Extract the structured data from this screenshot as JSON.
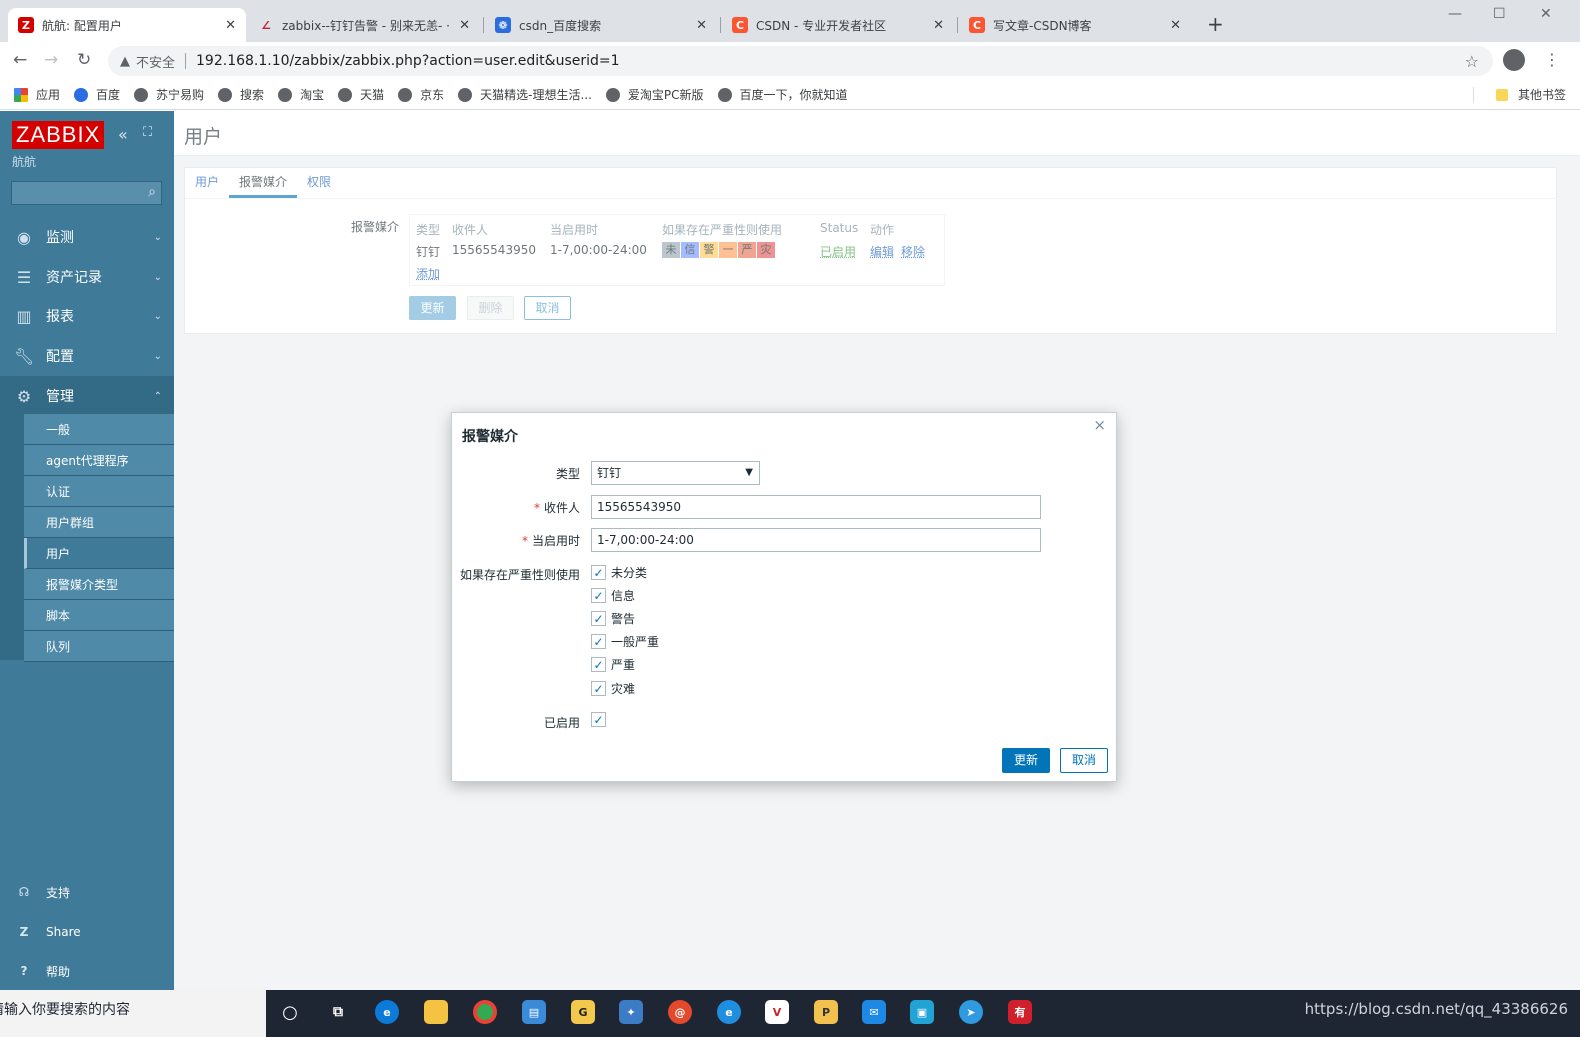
{
  "browser": {
    "tabs": [
      {
        "title": "航航: 配置用户",
        "icon": "zabbix-favicon",
        "color": "#d40000",
        "glyph": "Z"
      },
      {
        "title": "zabbix--钉钉告警 - 别来无恙- ·",
        "icon": "csdn-favicon",
        "color": "#c32136",
        "glyph": "∠"
      },
      {
        "title": "csdn_百度搜索",
        "icon": "baidu-favicon",
        "color": "#2b6de0",
        "glyph": "❁"
      },
      {
        "title": "CSDN - 专业开发者社区",
        "icon": "csdn-favicon",
        "color": "#fc5531",
        "glyph": "C"
      },
      {
        "title": "写文章-CSDN博客",
        "icon": "csdn-favicon",
        "color": "#fc5531",
        "glyph": "C"
      }
    ],
    "security_label": "不安全",
    "url": "192.168.1.10/zabbix/zabbix.php?action=user.edit&userid=1",
    "bookmarks": [
      "应用",
      "百度",
      "苏宁易购",
      "搜索",
      "淘宝",
      "天猫",
      "京东",
      "天猫精选-理想生活...",
      "爱淘宝PC新版",
      "百度一下，你就知道"
    ],
    "other_bookmarks": "其他书签"
  },
  "sidebar": {
    "logo": "ZABBIX",
    "subtitle": "航航",
    "menu": [
      {
        "label": "监测",
        "icon": "eye-icon"
      },
      {
        "label": "资产记录",
        "icon": "list-icon"
      },
      {
        "label": "报表",
        "icon": "bar-chart-icon"
      },
      {
        "label": "配置",
        "icon": "wrench-icon"
      },
      {
        "label": "管理",
        "icon": "gear-icon"
      }
    ],
    "admin_items": [
      "一般",
      "agent代理程序",
      "认证",
      "用户群组",
      "用户",
      "报警媒介类型",
      "脚本",
      "队列"
    ],
    "footer": [
      {
        "label": "支持",
        "icon": "headset-icon"
      },
      {
        "label": "Share",
        "icon": "share-z-icon"
      },
      {
        "label": "帮助",
        "icon": "help-icon"
      }
    ]
  },
  "page": {
    "title": "用户",
    "tabs": [
      "用户",
      "报警媒介",
      "权限"
    ],
    "media_label": "报警媒介",
    "media_table": {
      "headers": [
        "类型",
        "收件人",
        "当启用时",
        "如果存在严重性则使用",
        "Status",
        "动作"
      ],
      "row": {
        "type": "钉钉",
        "sendto": "15565543950",
        "period": "1-7,00:00-24:00",
        "severities": [
          {
            "label": "未",
            "color": "#97aab3"
          },
          {
            "label": "信",
            "color": "#7499ff"
          },
          {
            "label": "警",
            "color": "#ffc859"
          },
          {
            "label": "一",
            "color": "#ffa059"
          },
          {
            "label": "严",
            "color": "#e97659"
          },
          {
            "label": "灾",
            "color": "#e45959"
          }
        ],
        "status": "已启用",
        "edit": "编辑",
        "remove": "移除"
      },
      "add": "添加"
    },
    "buttons": {
      "update": "更新",
      "delete": "删除",
      "cancel": "取消"
    }
  },
  "dialog": {
    "title": "报警媒介",
    "type_label": "类型",
    "type_value": "钉钉",
    "sendto_label": "收件人",
    "sendto_value": "15565543950",
    "period_label": "当启用时",
    "period_value": "1-7,00:00-24:00",
    "severity_label": "如果存在严重性则使用",
    "severities": [
      "未分类",
      "信息",
      "警告",
      "一般严重",
      "严重",
      "灾难"
    ],
    "enabled_label": "已启用",
    "update": "更新",
    "cancel": "取消"
  },
  "taskbar": {
    "search_placeholder": "请输入你要搜索的内容",
    "status_text": "https://blog.csdn.net/qq_43386626"
  }
}
